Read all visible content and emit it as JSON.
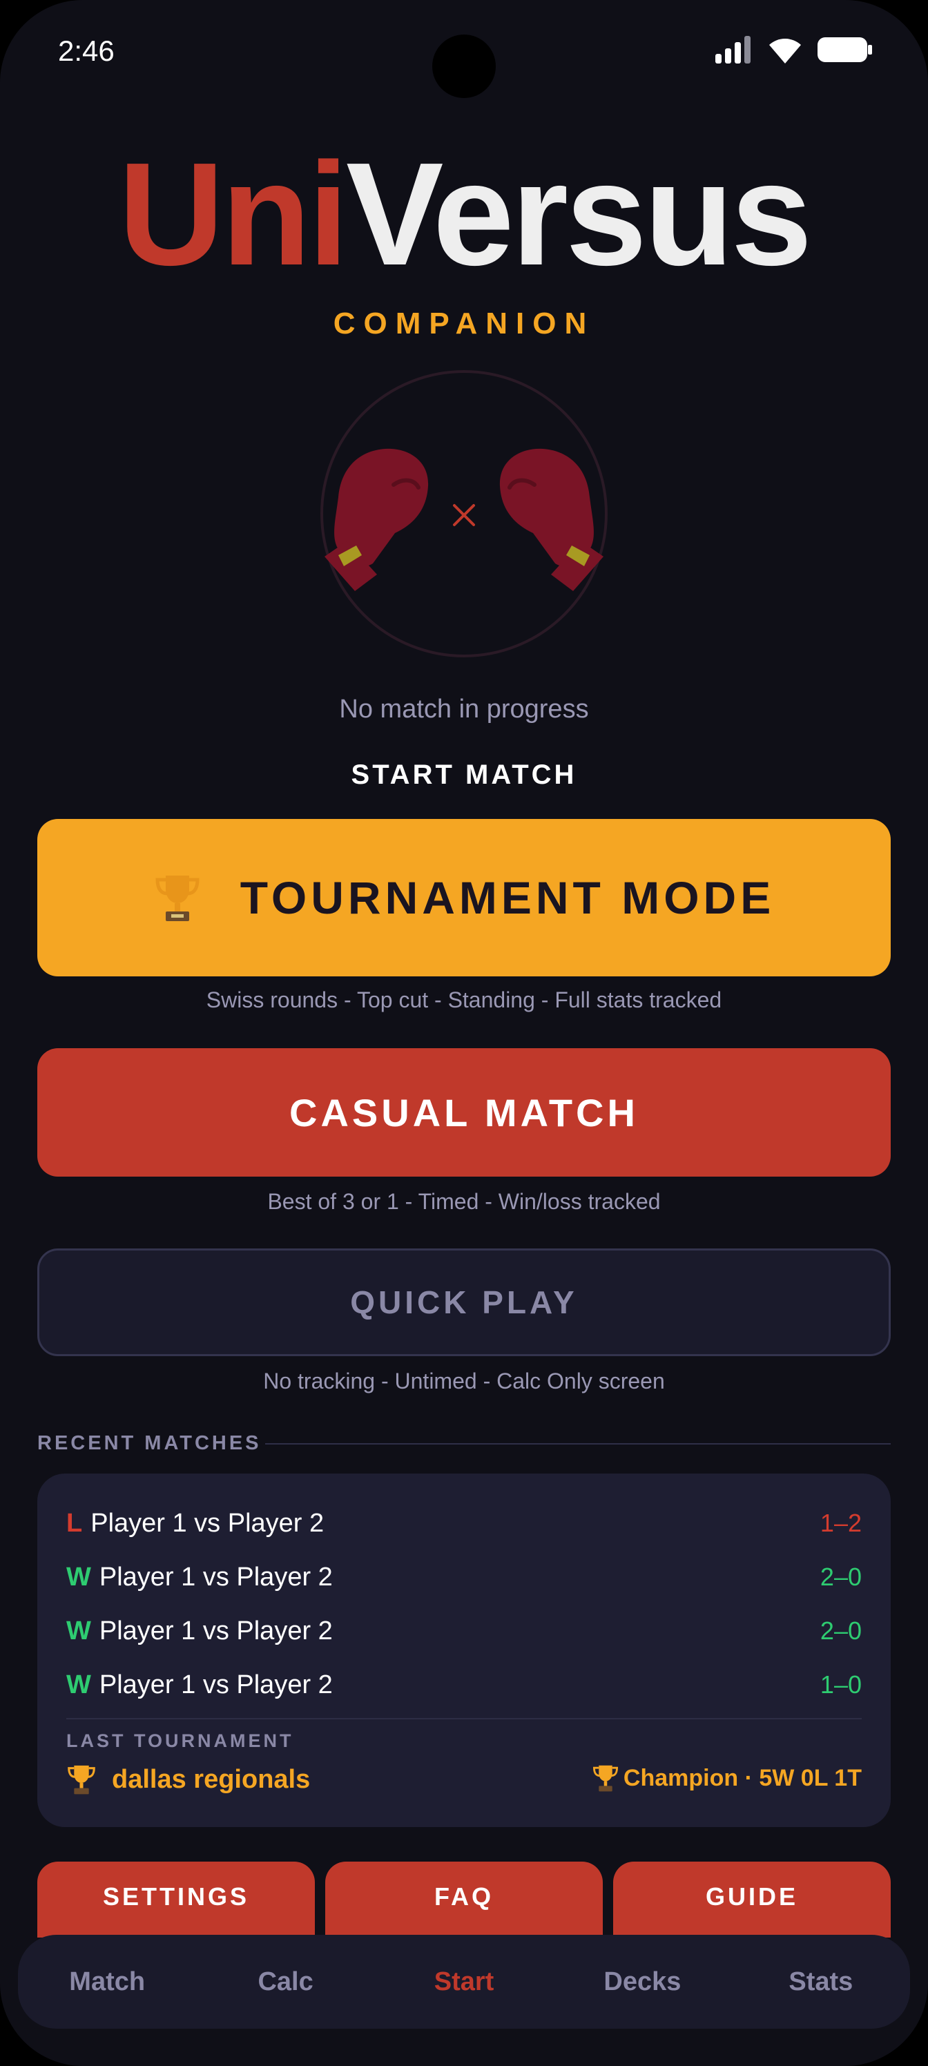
{
  "status_bar": {
    "time": "2:46"
  },
  "header": {
    "logo_part1": "Uni",
    "logo_part2": "Versus",
    "subtitle": "COMPANION"
  },
  "match_state": {
    "text": "No match in progress"
  },
  "start_section": {
    "label": "START MATCH",
    "tournament": {
      "label": "TOURNAMENT MODE",
      "caption": "Swiss rounds - Top cut - Standing - Full stats tracked"
    },
    "casual": {
      "label": "CASUAL MATCH",
      "caption": "Best of 3 or 1 - Timed - Win/loss tracked"
    },
    "quick": {
      "label": "QUICK PLAY",
      "caption": "No tracking - Untimed - Calc Only screen"
    }
  },
  "recent": {
    "title": "RECENT MATCHES",
    "matches": [
      {
        "result": "L",
        "players": "Player 1 vs Player 2",
        "score": "1–2"
      },
      {
        "result": "W",
        "players": "Player 1 vs Player 2",
        "score": "2–0"
      },
      {
        "result": "W",
        "players": "Player 1 vs Player 2",
        "score": "2–0"
      },
      {
        "result": "W",
        "players": "Player 1 vs Player 2",
        "score": "1–0"
      }
    ],
    "last_tournament": {
      "label": "LAST TOURNAMENT",
      "name": "dallas regionals",
      "result": "Champion · 5W 0L 1T"
    }
  },
  "quick_buttons": {
    "settings": "SETTINGS",
    "faq": "FAQ",
    "guide": "GUIDE"
  },
  "nav": {
    "items": [
      "Match",
      "Calc",
      "Start",
      "Decks",
      "Stats"
    ],
    "active": "Start"
  },
  "colors": {
    "background": "#0f0f17",
    "accent_red": "#c0392b",
    "accent_gold": "#f5a623",
    "win_green": "#2ecc71",
    "loss_red": "#d43c2e",
    "muted": "#8a88a6",
    "card": "#1e1e32"
  },
  "icons": [
    "signal-icon",
    "wifi-icon",
    "battery-icon",
    "boxing-gloves-icon",
    "trophy-icon"
  ]
}
